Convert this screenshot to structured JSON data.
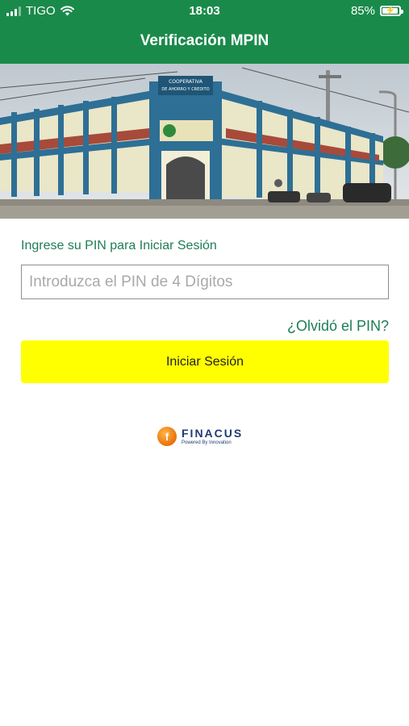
{
  "status_bar": {
    "carrier": "TIGO",
    "time": "18:03",
    "battery_percent": "85%",
    "battery_level": 0.85,
    "icons": [
      "signal-icon",
      "wifi-icon",
      "battery-charging-icon"
    ]
  },
  "header": {
    "title": "Verificación MPIN"
  },
  "banner": {
    "building_sign": "COOPERATIVA DE AHORRO Y CREDITO"
  },
  "login": {
    "prompt": "Ingrese su PIN para Iniciar Sesión",
    "pin_placeholder": "Introduzca el PIN de 4 Dígitos",
    "pin_value": "",
    "forgot_label": "¿Olvidó el PIN?",
    "submit_label": "Iniciar Sesión"
  },
  "footer_logo": {
    "brand": "FINACUS",
    "tagline": "Powered By Innovation"
  },
  "colors": {
    "header_bg": "#1a8a4a",
    "accent_text": "#1e7d55",
    "button_bg": "#ffff00",
    "logo_blue": "#1f3b73",
    "logo_orange": "#e8710a"
  }
}
